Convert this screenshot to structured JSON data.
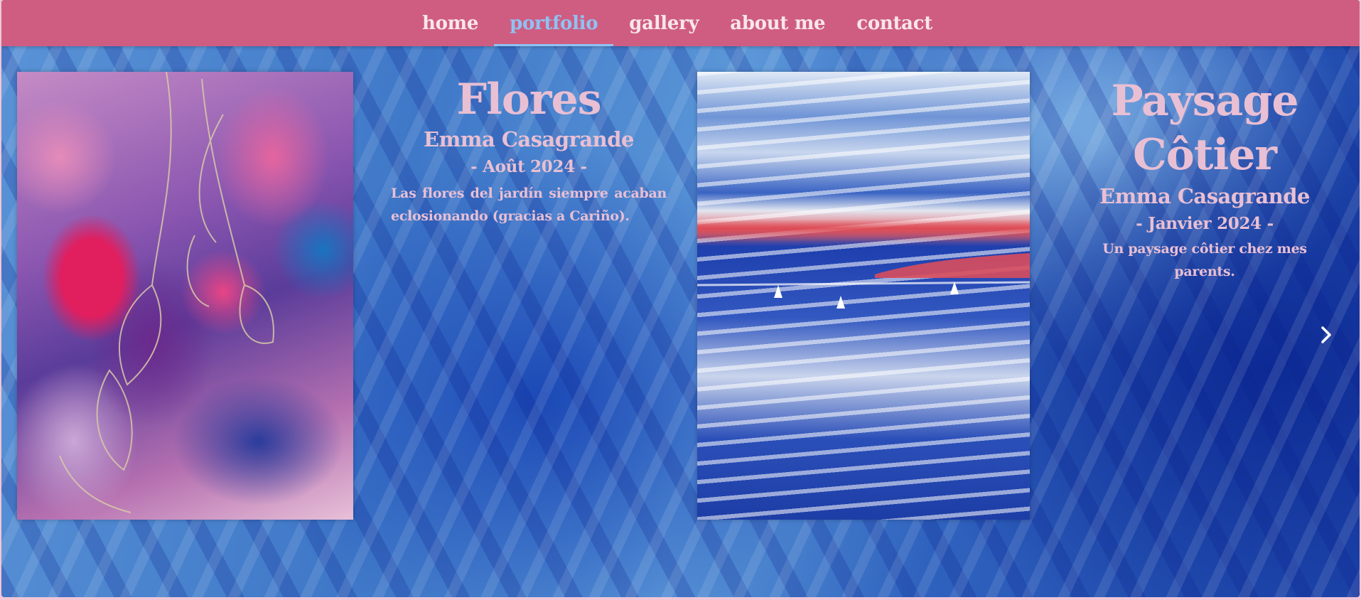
{
  "nav": {
    "items": [
      {
        "label": "home",
        "active": false
      },
      {
        "label": "portfolio",
        "active": true
      },
      {
        "label": "gallery",
        "active": false
      },
      {
        "label": "about me",
        "active": false
      },
      {
        "label": "contact",
        "active": false
      }
    ],
    "active_color": "#8fc2f2",
    "bar_color": "#cf5d82"
  },
  "artworks": [
    {
      "title": "Flores",
      "artist": "Emma Casagrande",
      "date": "- Août 2024 -",
      "description": "Las flores del jardín siempre acaban eclosionando (gracias a Cariño)."
    },
    {
      "title_line1": "Paysage",
      "title_line2": "Côtier",
      "artist": "Emma Casagrande",
      "date": "- Janvier 2024 -",
      "description": "Un paysage côtier chez mes parents."
    }
  ],
  "controls": {
    "next_icon": "chevron-right-icon"
  },
  "colors": {
    "text_pink": "#e9bfd3",
    "background_blue": "#3f78c8"
  }
}
